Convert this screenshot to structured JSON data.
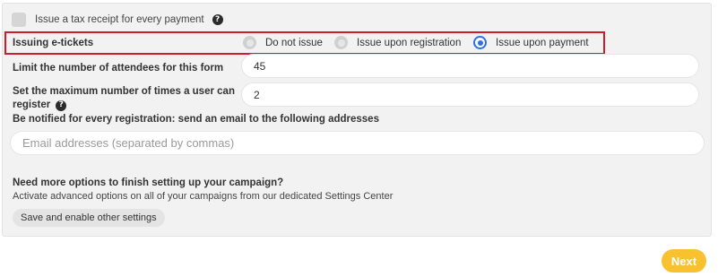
{
  "tax_receipt": {
    "label": "Issue a tax receipt for every payment",
    "help": "?"
  },
  "etickets": {
    "label": "Issuing e-tickets",
    "options": [
      {
        "label": "Do not issue",
        "selected": false
      },
      {
        "label": "Issue upon registration",
        "selected": false
      },
      {
        "label": "Issue upon payment",
        "selected": true
      }
    ]
  },
  "attendee_limit": {
    "label": "Limit the number of attendees for this form",
    "value": "45"
  },
  "max_registrations": {
    "label_line1": "Set the maximum number of times a user can",
    "label_line2": "register",
    "help": "?",
    "value": "2"
  },
  "notify": {
    "label": "Be notified for every registration: send an email to the following addresses",
    "placeholder": "Email addresses (separated by commas)"
  },
  "promo": {
    "title": "Need more options to finish setting up your campaign?",
    "text": "Activate advanced options on all of your campaigns from our dedicated Settings Center",
    "button": "Save and enable other settings"
  },
  "footer": {
    "next": "Next"
  },
  "colors": {
    "highlight_border": "#d11a2a",
    "radio_selected": "#2f6fe4",
    "next_button": "#f8c130"
  }
}
